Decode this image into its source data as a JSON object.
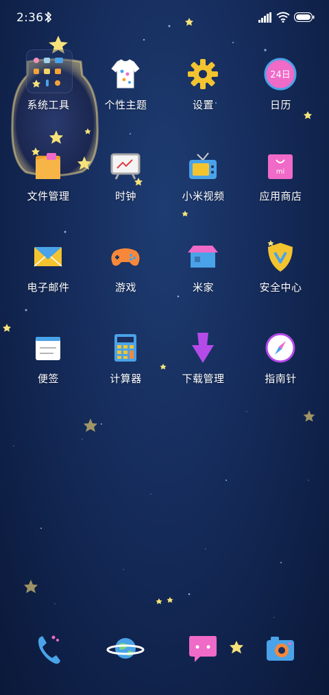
{
  "status_bar": {
    "time": "2:36",
    "bluetooth_icon": "bluetooth-icon",
    "signal_icon": "cell-signal-icon",
    "wifi_icon": "wifi-icon",
    "battery_icon": "battery-icon"
  },
  "apps": [
    {
      "label": "系统工具",
      "icon": "folder-icon"
    },
    {
      "label": "个性主题",
      "icon": "tshirt-icon"
    },
    {
      "label": "设置",
      "icon": "gear-icon"
    },
    {
      "label": "日历",
      "icon": "calendar-icon",
      "badge": "24日"
    },
    {
      "label": "文件管理",
      "icon": "file-folder-icon"
    },
    {
      "label": "时钟",
      "icon": "clock-board-icon"
    },
    {
      "label": "小米视频",
      "icon": "tv-icon"
    },
    {
      "label": "应用商店",
      "icon": "shopping-bag-icon",
      "badge": "mi"
    },
    {
      "label": "电子邮件",
      "icon": "envelope-icon"
    },
    {
      "label": "游戏",
      "icon": "gamepad-icon"
    },
    {
      "label": "米家",
      "icon": "house-icon"
    },
    {
      "label": "安全中心",
      "icon": "shield-icon"
    },
    {
      "label": "便签",
      "icon": "note-icon"
    },
    {
      "label": "计算器",
      "icon": "calculator-icon"
    },
    {
      "label": "下载管理",
      "icon": "download-arrow-icon"
    },
    {
      "label": "指南针",
      "icon": "compass-icon"
    }
  ],
  "dock": [
    {
      "icon": "phone-icon"
    },
    {
      "icon": "planet-browser-icon"
    },
    {
      "icon": "message-bubble-icon"
    },
    {
      "icon": "camera-icon"
    }
  ],
  "colors": {
    "background_top": "#1e3c72",
    "background_bottom": "#0b1838",
    "star": "#f5e27a",
    "calendar_pink": "#f06ac8",
    "folder_orange": "#f7a23a",
    "gear_yellow": "#f4c430"
  }
}
